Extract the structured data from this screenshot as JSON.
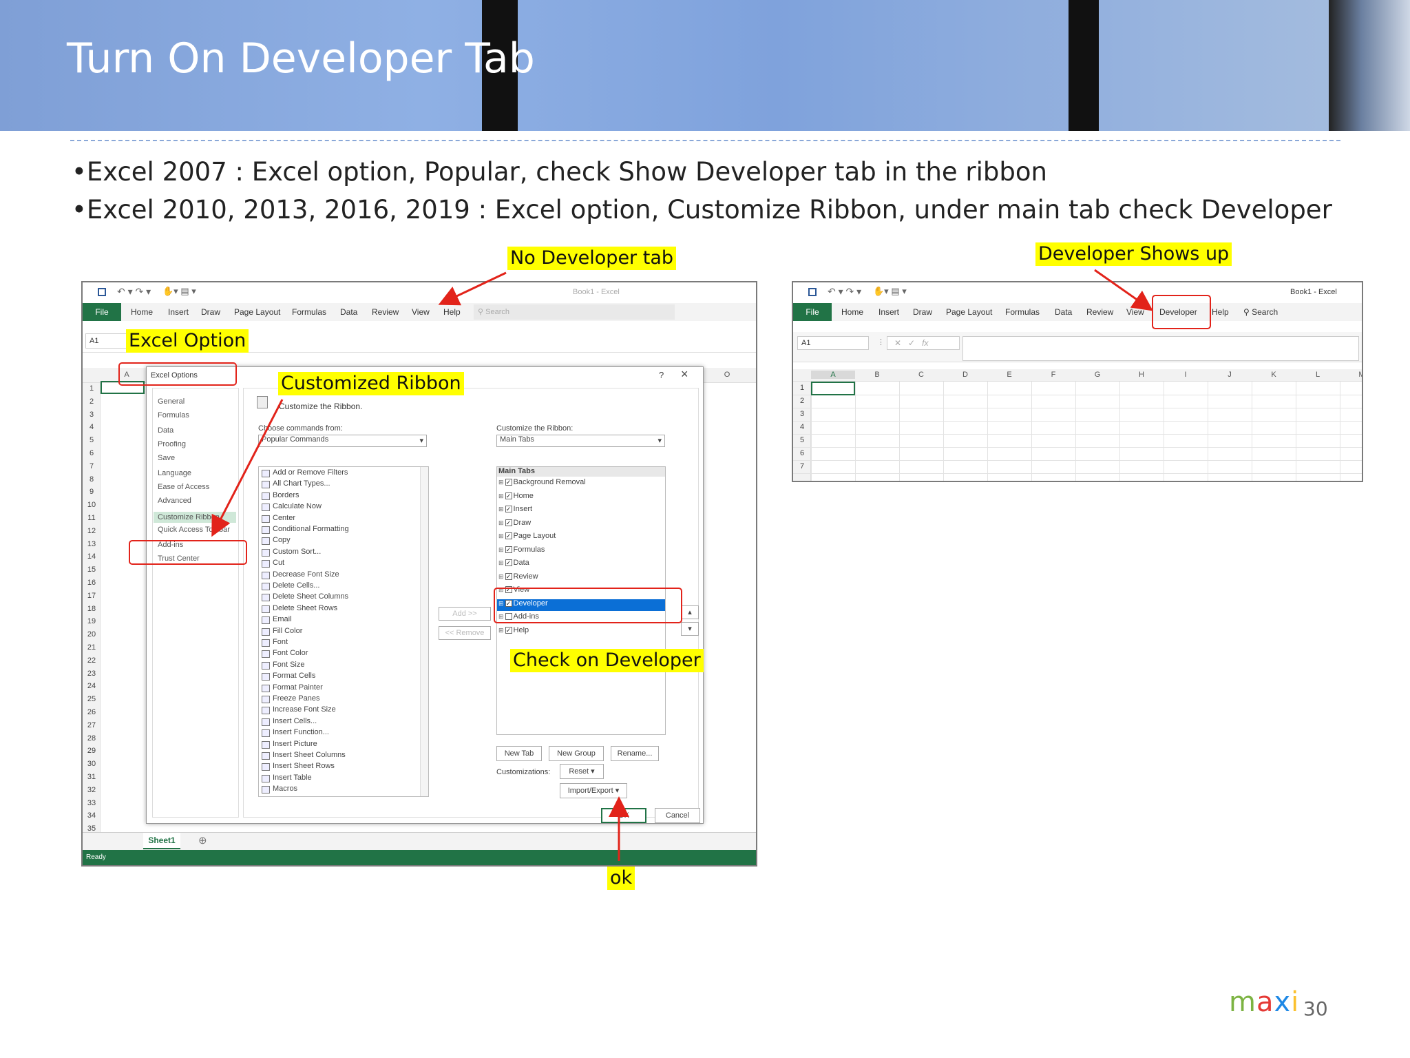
{
  "slide": {
    "title": "Turn On Developer Tab",
    "bullets": [
      "•Excel 2007 : Excel option, Popular, check Show Developer  tab in the ribbon",
      "•Excel 2010, 2013, 2016, 2019 : Excel option, Customize  Ribbon, under main tab check Developer"
    ],
    "page_number": "30",
    "logo": {
      "letters": [
        "m",
        "a",
        "x",
        "i"
      ],
      "colors": [
        "#7cb342",
        "#e53935",
        "#1e88e5",
        "#fbc02d"
      ]
    }
  },
  "callouts": {
    "no_developer": "No Developer tab",
    "excel_option": "Excel Option",
    "customized_ribbon": "Customized  Ribbon",
    "check_developer": "Check on Developer",
    "ok": "ok",
    "developer_shows": "Developer Shows up"
  },
  "colors": {
    "highlight": "#ffff00",
    "annotation_red": "#e2231a",
    "excel_green": "#217346"
  },
  "left_excel": {
    "window_title": "Book1  -  Excel",
    "tabs": [
      "File",
      "Home",
      "Insert",
      "Draw",
      "Page Layout",
      "Formulas",
      "Data",
      "Review",
      "View",
      "Help"
    ],
    "search": "Search",
    "name_box": "A1",
    "col_a": "A",
    "col_o": "O",
    "rows": [
      "1",
      "2",
      "3",
      "4",
      "5",
      "6",
      "7",
      "8",
      "9",
      "10",
      "11",
      "12",
      "13",
      "14",
      "15",
      "16",
      "17",
      "18",
      "19",
      "20",
      "21",
      "22",
      "23",
      "24",
      "25",
      "26",
      "27",
      "28",
      "29",
      "30",
      "31",
      "32",
      "33",
      "34",
      "35"
    ],
    "sheet_tab": "Sheet1",
    "status": "Ready"
  },
  "dialog": {
    "title": "Excel Options",
    "help": "?",
    "close": "×",
    "nav": [
      "General",
      "Formulas",
      "Data",
      "Proofing",
      "Save",
      "Language",
      "Ease of Access",
      "Advanced",
      "Customize Ribbon",
      "Quick Access Toolbar",
      "Add-ins",
      "Trust Center"
    ],
    "heading": "Customize the Ribbon.",
    "choose_label": "Choose commands from:",
    "choose_value": "Popular Commands",
    "customize_label": "Customize the Ribbon:",
    "customize_value": "Main Tabs",
    "commands": [
      "Add or Remove Filters",
      "All Chart Types...",
      "Borders",
      "Calculate Now",
      "Center",
      "Conditional Formatting",
      "Copy",
      "Custom Sort...",
      "Cut",
      "Decrease Font Size",
      "Delete Cells...",
      "Delete Sheet Columns",
      "Delete Sheet Rows",
      "Email",
      "Fill Color",
      "Font",
      "Font Color",
      "Font Size",
      "Format Cells",
      "Format Painter",
      "Freeze Panes",
      "Increase Font Size",
      "Insert Cells...",
      "Insert Function...",
      "Insert Picture",
      "Insert Sheet Columns",
      "Insert Sheet Rows",
      "Insert Table",
      "Macros"
    ],
    "main_tabs_header": "Main Tabs",
    "main_tabs": [
      {
        "label": "Background Removal",
        "checked": true
      },
      {
        "label": "Home",
        "checked": true
      },
      {
        "label": "Insert",
        "checked": true
      },
      {
        "label": "Draw",
        "checked": true
      },
      {
        "label": "Page Layout",
        "checked": true
      },
      {
        "label": "Formulas",
        "checked": true
      },
      {
        "label": "Data",
        "checked": true
      },
      {
        "label": "Review",
        "checked": true
      },
      {
        "label": "View",
        "checked": true
      },
      {
        "label": "Developer",
        "checked": true
      },
      {
        "label": "Add-ins",
        "checked": false
      },
      {
        "label": "Help",
        "checked": true
      }
    ],
    "add_btn": "Add >>",
    "remove_btn": "<< Remove",
    "new_tab": "New Tab",
    "new_group": "New Group",
    "rename": "Rename...",
    "customizations_label": "Customizations:",
    "reset": "Reset ▾",
    "import_export": "Import/Export ▾",
    "ok": "OK",
    "cancel": "Cancel"
  },
  "right_excel": {
    "window_title": "Book1  -  Excel",
    "tabs": [
      "File",
      "Home",
      "Insert",
      "Draw",
      "Page Layout",
      "Formulas",
      "Data",
      "Review",
      "View",
      "Developer",
      "Help"
    ],
    "search": "Search",
    "name_box": "A1",
    "columns": [
      "A",
      "B",
      "C",
      "D",
      "E",
      "F",
      "G",
      "H",
      "I",
      "J",
      "K",
      "L",
      "M"
    ],
    "rows": [
      "1",
      "2",
      "3",
      "4",
      "5",
      "6",
      "7"
    ]
  }
}
